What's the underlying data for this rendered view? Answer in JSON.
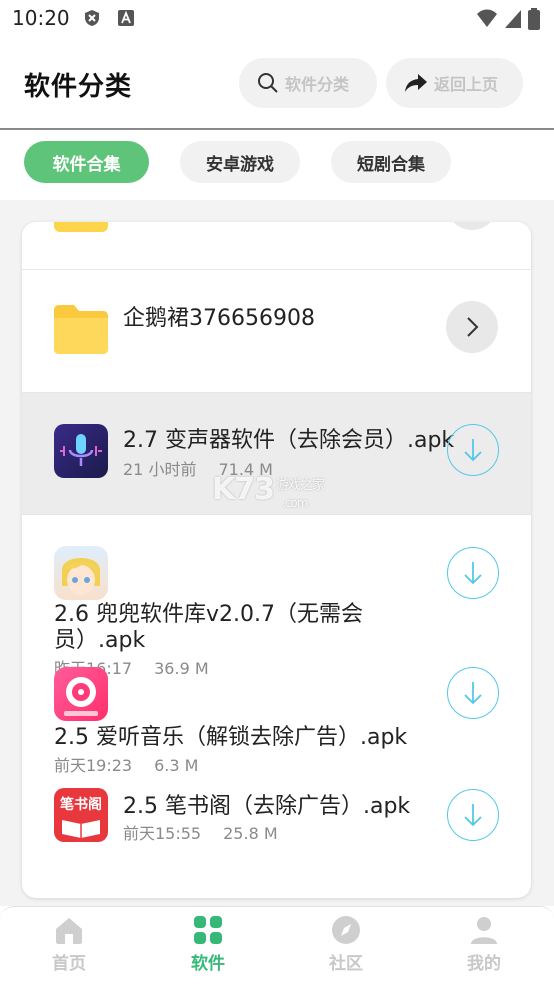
{
  "status_bar": {
    "time": "10:20"
  },
  "header": {
    "title": "软件分类",
    "search_label": "软件分类",
    "back_label": "返回上页"
  },
  "tabs": [
    {
      "label": "软件合集",
      "active": true
    },
    {
      "label": "安卓游戏",
      "active": false
    },
    {
      "label": "短剧合集",
      "active": false
    }
  ],
  "list": {
    "folder": {
      "name": "企鹅裙376656908"
    },
    "files": [
      {
        "name": "2.7 变声器软件（去除会员）.apk",
        "time": "21 小时前",
        "size": "71.4 M",
        "icon": "voice-changer-icon"
      },
      {
        "name_line1": "2.6 兜兜软件库v2.0.7（无需会",
        "name_line2": "员）.apk",
        "time": "昨天16:17",
        "size": "36.9 M",
        "icon": "anime-avatar-icon"
      },
      {
        "name": "2.5 爱听音乐（解锁去除广告）.apk",
        "time": "前天19:23",
        "size": "6.3 M",
        "icon": "music-app-icon"
      },
      {
        "name": "2.5 笔书阁（去除广告）.apk",
        "time": "前天15:55",
        "size": "25.8 M",
        "icon": "book-app-icon",
        "icon_text": "笔书阁"
      }
    ]
  },
  "watermark": {
    "main": "K73",
    "sub": "游戏之家",
    "domain": ".com"
  },
  "bottom_nav": [
    {
      "label": "首页",
      "icon": "home-icon",
      "active": false
    },
    {
      "label": "软件",
      "icon": "grid-icon",
      "active": true
    },
    {
      "label": "社区",
      "icon": "compass-icon",
      "active": false
    },
    {
      "label": "我的",
      "icon": "person-icon",
      "active": false
    }
  ],
  "colors": {
    "accent_green": "#5ec47a",
    "nav_active": "#36b879",
    "download_blue": "#54c8e8"
  }
}
